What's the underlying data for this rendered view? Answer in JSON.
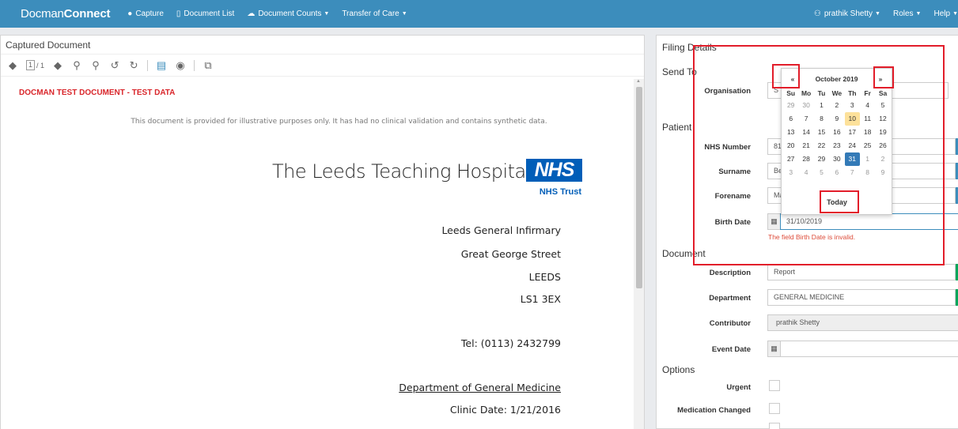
{
  "navbar": {
    "brand_prefix": "Docman",
    "brand_suffix": "Connect",
    "capture": "Capture",
    "document_list": "Document List",
    "document_counts": "Document Counts",
    "transfer_of_care": "Transfer of Care",
    "user": "prathik Shetty",
    "roles": "Roles",
    "help": "Help"
  },
  "viewer": {
    "title": "Captured Document",
    "page_current": "1",
    "page_total": "/ 1"
  },
  "document": {
    "banner": "DOCMAN TEST DOCUMENT - TEST DATA",
    "disclaimer": "This document is provided for illustrative purposes only. It has had no clinical validation and contains synthetic data.",
    "hospital_name": "The Leeds Teaching Hospitals",
    "nhs_logo": "NHS",
    "nhs_trust": "NHS Trust",
    "address_line1": "Leeds General Infirmary",
    "address_line2": "Great George Street",
    "address_city": "LEEDS",
    "address_postcode": "LS1 3EX",
    "tel": "Tel: (0113) 2432799",
    "department": "Department of General Medicine",
    "clinic_date": "Clinic Date: 1/21/2016"
  },
  "filing": {
    "title": "Filing Details",
    "send_to_heading": "Send To",
    "organisation_label": "Organisation",
    "organisation_value": "S",
    "patient_heading": "Patient",
    "nhs_number_label": "NHS Number",
    "nhs_number_value": "817",
    "surname_label": "Surname",
    "surname_value": "Bev",
    "forename_label": "Forename",
    "forename_value": "Mar",
    "birth_date_label": "Birth Date",
    "birth_date_value": "31/10/2019",
    "birth_date_error": "The field Birth Date is invalid.",
    "document_heading": "Document",
    "description_label": "Description",
    "description_value": "Report",
    "department_label": "Department",
    "department_value": "GENERAL MEDICINE",
    "contributor_label": "Contributor",
    "contributor_value": "prathik Shetty",
    "event_date_label": "Event Date",
    "options_heading": "Options",
    "urgent_label": "Urgent",
    "medication_changed_label": "Medication Changed"
  },
  "datepicker": {
    "prev": "«",
    "next": "»",
    "month_title": "October 2019",
    "days_of_week": [
      "Su",
      "Mo",
      "Tu",
      "We",
      "Th",
      "Fr",
      "Sa"
    ],
    "days": [
      {
        "d": "29",
        "old": true
      },
      {
        "d": "30",
        "old": true
      },
      {
        "d": "1"
      },
      {
        "d": "2"
      },
      {
        "d": "3"
      },
      {
        "d": "4"
      },
      {
        "d": "5"
      },
      {
        "d": "6"
      },
      {
        "d": "7"
      },
      {
        "d": "8"
      },
      {
        "d": "9"
      },
      {
        "d": "10",
        "today": true
      },
      {
        "d": "11"
      },
      {
        "d": "12"
      },
      {
        "d": "13"
      },
      {
        "d": "14"
      },
      {
        "d": "15"
      },
      {
        "d": "16"
      },
      {
        "d": "17"
      },
      {
        "d": "18"
      },
      {
        "d": "19"
      },
      {
        "d": "20"
      },
      {
        "d": "21"
      },
      {
        "d": "22"
      },
      {
        "d": "23"
      },
      {
        "d": "24"
      },
      {
        "d": "25"
      },
      {
        "d": "26"
      },
      {
        "d": "27"
      },
      {
        "d": "28"
      },
      {
        "d": "29"
      },
      {
        "d": "30"
      },
      {
        "d": "31",
        "active": true
      },
      {
        "d": "1",
        "old": true
      },
      {
        "d": "2",
        "old": true
      },
      {
        "d": "3",
        "old": true
      },
      {
        "d": "4",
        "old": true
      },
      {
        "d": "5",
        "old": true
      },
      {
        "d": "6",
        "old": true
      },
      {
        "d": "7",
        "old": true
      },
      {
        "d": "8",
        "old": true
      },
      {
        "d": "9",
        "old": true
      }
    ],
    "today_button": "Today"
  },
  "colors": {
    "navbar": "#3c8dbc",
    "error": "#dd4b39",
    "annotation": "#e21d2a",
    "nhs_blue": "#005eb8"
  },
  "icons": {
    "capture": "circle-plus-icon",
    "document_list": "file-icon",
    "document_counts": "cloud-icon",
    "user": "user-icon",
    "calendar": "calendar-icon"
  }
}
